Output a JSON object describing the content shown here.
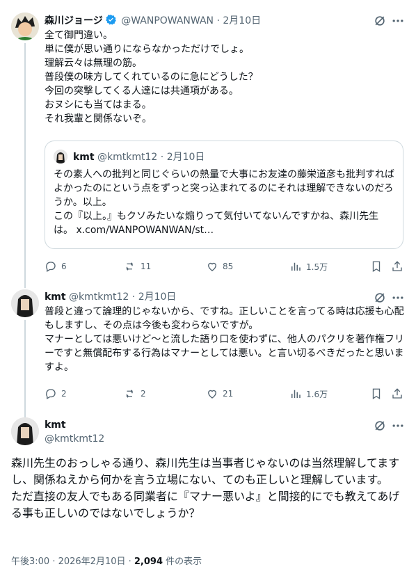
{
  "tweet1": {
    "display_name": "森川ジョージ",
    "handle": "@WANPOWANWAN",
    "date": "2月10日",
    "body": "全て御門違い。\n単に僕が思い通りにならなかっただけでしょ。\n理解云々は無理の筋。\n普段僕の味方してくれているのに急にどうした？\n今回の突撃してくる人達には共通項がある。\nおヌシにも当てはまる。\nそれ我輩と関係ないぞ。",
    "quote": {
      "display_name": "kmt",
      "handle": "@kmtkmt12",
      "date": "2月10日",
      "body": "その素人への批判と同じぐらいの熱量で大事にお友達の藤栄道彦も批判すればよかったのにという点をずっと突っ込まれてるのにそれは理解できないのだろうか。以上。\nこの『以上。』もクソみたいな煽りって気付いてないんですかね、森川先生は。 x.com/WANPOWANWAN/st…"
    },
    "replies": "6",
    "reposts": "11",
    "likes": "85",
    "views": "1.5万"
  },
  "tweet2": {
    "display_name": "kmt",
    "handle": "@kmtkmt12",
    "date": "2月10日",
    "body": "普段と違って論理的じゃないから、ですね。正しいことを言ってる時は応援も心配もしますし、その点は今後も変わらないですが。\nマナーとしては悪いけど～と流した語り口を使わずに、他人のパクリを著作権フリーですと無償配布する行為はマナーとしては悪い。と言い切るべきだったと思いますよ。",
    "replies": "2",
    "reposts": "2",
    "likes": "21",
    "views": "1.6万"
  },
  "focal": {
    "display_name": "kmt",
    "handle": "@kmtkmt12",
    "body": "森川先生のおっしゃる通り、森川先生は当事者じゃないのは当然理解してますし、関係ねえから何かを言う立場にない、てのも正しいと理解しています。\nただ直接の友人でもある同業者に『マナー悪いよ』と間接的にでも教えてあげる事も正しいのではないでしょうか？",
    "time": "午後3:00 · 2026年2月10日 · ",
    "views_count": "2,094",
    "views_label": " 件の表示"
  },
  "colors": {
    "text": "#0f1419",
    "muted": "#536471",
    "verified": "#1d9bf0",
    "border": "#cfd9de"
  },
  "icons": [
    "grok-icon",
    "more-icon",
    "reply-icon",
    "repost-icon",
    "like-icon",
    "views-icon",
    "bookmark-icon",
    "share-icon",
    "verified-badge-icon"
  ]
}
